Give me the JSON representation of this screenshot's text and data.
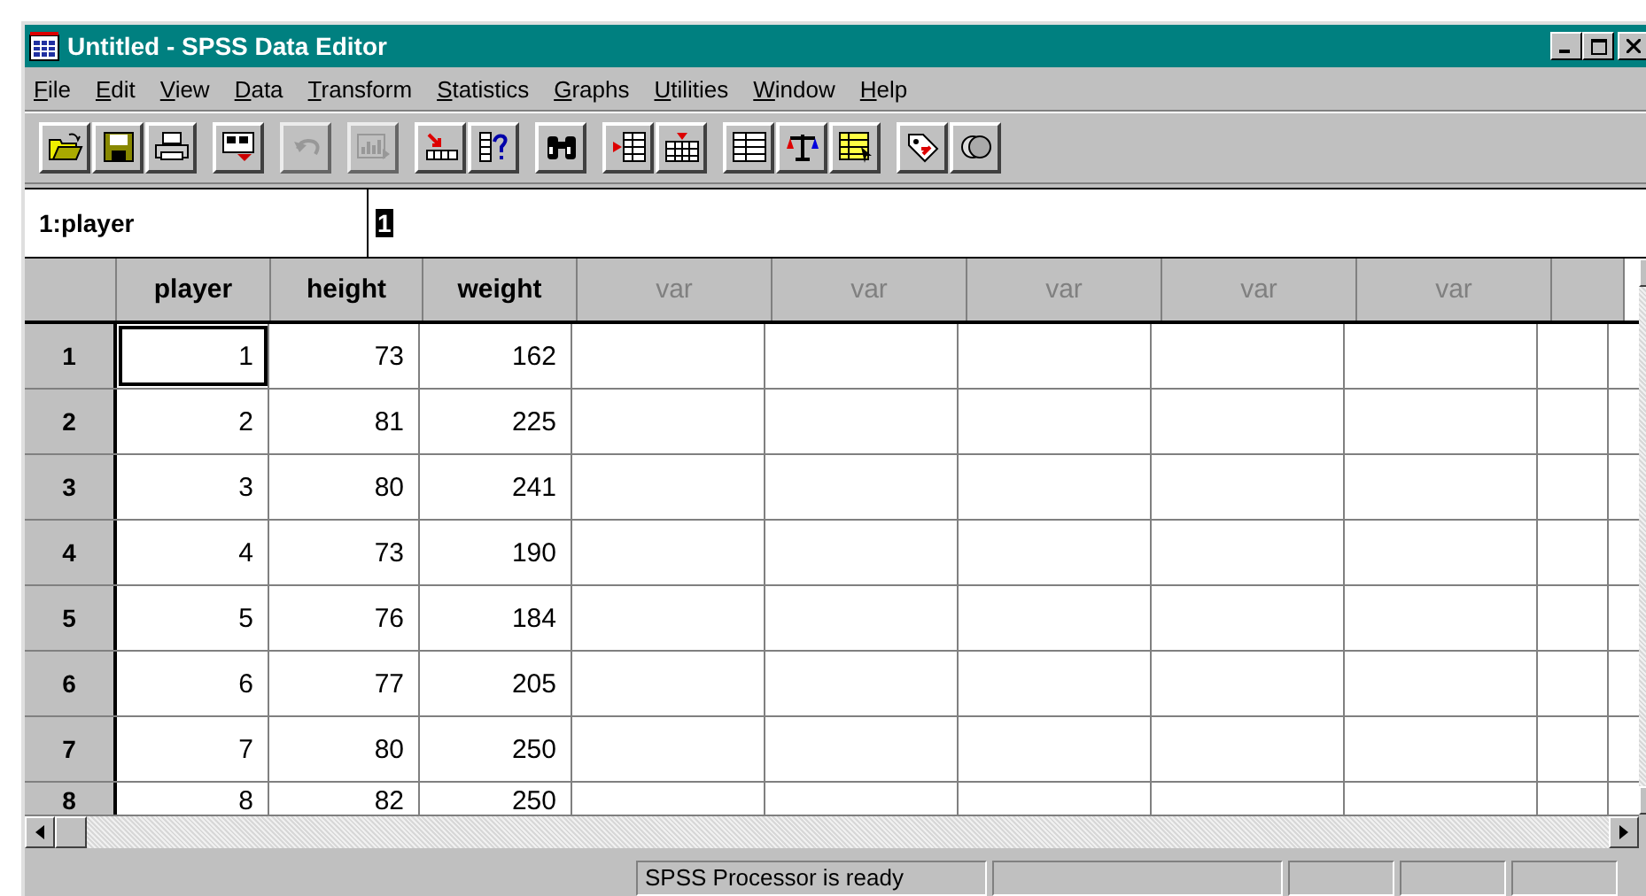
{
  "window": {
    "title": "Untitled - SPSS Data Editor"
  },
  "menu": [
    {
      "label": "File"
    },
    {
      "label": "Edit"
    },
    {
      "label": "View"
    },
    {
      "label": "Data"
    },
    {
      "label": "Transform"
    },
    {
      "label": "Statistics"
    },
    {
      "label": "Graphs"
    },
    {
      "label": "Utilities"
    },
    {
      "label": "Window"
    },
    {
      "label": "Help"
    }
  ],
  "toolbar": {
    "groups": [
      {
        "buttons": [
          {
            "kind": "open",
            "disabled": false
          },
          {
            "kind": "save",
            "disabled": false
          },
          {
            "kind": "print",
            "disabled": false
          }
        ]
      },
      {
        "buttons": [
          {
            "kind": "dialog",
            "disabled": false
          }
        ]
      },
      {
        "buttons": [
          {
            "kind": "undo",
            "disabled": true
          }
        ]
      },
      {
        "buttons": [
          {
            "kind": "chart",
            "disabled": true
          }
        ]
      },
      {
        "buttons": [
          {
            "kind": "goto",
            "disabled": false
          },
          {
            "kind": "info",
            "disabled": false
          }
        ]
      },
      {
        "buttons": [
          {
            "kind": "find",
            "disabled": false
          }
        ]
      },
      {
        "buttons": [
          {
            "kind": "insert_case",
            "disabled": false
          },
          {
            "kind": "insert_var",
            "disabled": false
          }
        ]
      },
      {
        "buttons": [
          {
            "kind": "split",
            "disabled": false
          },
          {
            "kind": "weight",
            "disabled": false
          },
          {
            "kind": "select",
            "disabled": false
          }
        ]
      },
      {
        "buttons": [
          {
            "kind": "labels",
            "disabled": false
          },
          {
            "kind": "sets",
            "disabled": false
          }
        ]
      }
    ]
  },
  "cell_editor": {
    "reference": "1:player",
    "value": "1"
  },
  "grid": {
    "columns": [
      {
        "heading": "player",
        "kind": "variable"
      },
      {
        "heading": "height",
        "kind": "variable"
      },
      {
        "heading": "weight",
        "kind": "variable"
      },
      {
        "heading": "var",
        "kind": "empty"
      },
      {
        "heading": "var",
        "kind": "empty"
      },
      {
        "heading": "var",
        "kind": "empty"
      },
      {
        "heading": "var",
        "kind": "empty"
      },
      {
        "heading": "var",
        "kind": "empty"
      }
    ],
    "rows": [
      {
        "label": "1",
        "cells": [
          {
            "value": "1",
            "active": true
          },
          {
            "value": "73",
            "active": false
          },
          {
            "value": "162",
            "active": false
          }
        ]
      },
      {
        "label": "2",
        "cells": [
          {
            "value": "2",
            "active": false
          },
          {
            "value": "81",
            "active": false
          },
          {
            "value": "225",
            "active": false
          }
        ]
      },
      {
        "label": "3",
        "cells": [
          {
            "value": "3",
            "active": false
          },
          {
            "value": "80",
            "active": false
          },
          {
            "value": "241",
            "active": false
          }
        ]
      },
      {
        "label": "4",
        "cells": [
          {
            "value": "4",
            "active": false
          },
          {
            "value": "73",
            "active": false
          },
          {
            "value": "190",
            "active": false
          }
        ]
      },
      {
        "label": "5",
        "cells": [
          {
            "value": "5",
            "active": false
          },
          {
            "value": "76",
            "active": false
          },
          {
            "value": "184",
            "active": false
          }
        ]
      },
      {
        "label": "6",
        "cells": [
          {
            "value": "6",
            "active": false
          },
          {
            "value": "77",
            "active": false
          },
          {
            "value": "205",
            "active": false
          }
        ]
      },
      {
        "label": "7",
        "cells": [
          {
            "value": "7",
            "active": false
          },
          {
            "value": "80",
            "active": false
          },
          {
            "value": "250",
            "active": false
          }
        ]
      },
      {
        "label": "8",
        "cells": [
          {
            "value": "8",
            "active": false
          },
          {
            "value": "82",
            "active": false
          },
          {
            "value": "250",
            "active": false
          }
        ]
      }
    ]
  },
  "status_bar": {
    "message": "SPSS Processor is ready"
  }
}
